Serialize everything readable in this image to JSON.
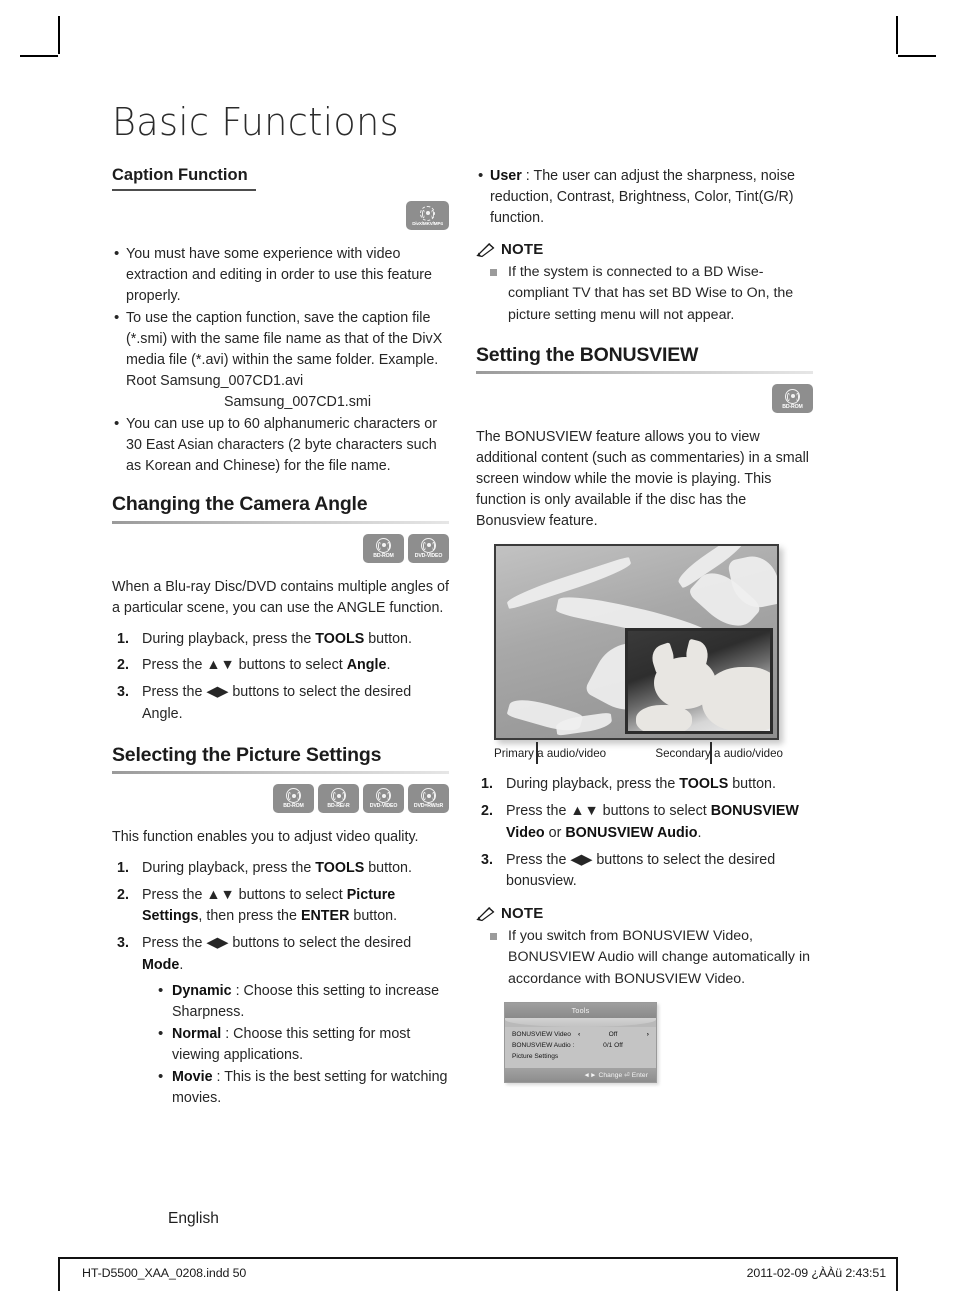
{
  "page": {
    "chapter_title": "Basic Functions",
    "language_label": "English",
    "footer_left": "HT-D5500_XAA_0208.indd   50",
    "footer_right": "2011-02-09   ¿ÀÀü 2:43:51"
  },
  "icons": {
    "divx": "DivX/MKV/MP4",
    "bd_rom": "BD-ROM",
    "bd_re_r": "BD-RE/-R",
    "dvd_video": "DVD-VIDEO",
    "dvd_rw_r": "DVD=RW/±R"
  },
  "left_column": {
    "caption_function": {
      "heading": "Caption Function",
      "bullets": [
        "You must have some experience with video extraction and editing in order to use this feature properly.",
        "To use the caption function, save the caption file (*.smi) with the same file name as that of the DivX media file (*.avi) within the same folder. Example. Root Samsung_007CD1.avi",
        "You can use up to 60 alphanumeric characters or 30 East Asian characters (2 byte characters such as Korean and Chinese) for the file name."
      ],
      "indented_line": "Samsung_007CD1.smi"
    },
    "camera_angle": {
      "heading": "Changing the Camera Angle",
      "intro": "When a Blu-ray Disc/DVD contains multiple angles of a particular scene, you can use the ANGLE function.",
      "steps": [
        {
          "pre": "During playback, press the ",
          "bold": "TOOLS",
          "post": " button."
        },
        {
          "pre": "Press the ▲▼ buttons to select ",
          "bold": "Angle",
          "post": "."
        },
        {
          "pre": "Press the ◀▶ buttons to select the desired ",
          "bold": "",
          "post": "Angle."
        }
      ]
    },
    "picture_settings": {
      "heading": "Selecting the Picture Settings",
      "intro": "This function enables you to adjust video quality.",
      "step1_pre": "During playback, press the ",
      "step1_bold": "TOOLS",
      "step1_post": " button.",
      "step2_pre": "Press the ▲▼ buttons to select ",
      "step2_bold1": "Picture Settings",
      "step2_mid": ", then press the ",
      "step2_bold2": "ENTER",
      "step2_post": " button.",
      "step3_pre": "Press the ◀▶ buttons to select the desired ",
      "step3_bold": "Mode",
      "step3_post": ".",
      "modes": [
        {
          "name": "Dynamic",
          "desc": " : Choose this setting to increase Sharpness."
        },
        {
          "name": "Normal",
          "desc": " : Choose this setting for most viewing applications."
        },
        {
          "name": "Movie",
          "desc": " : This is the best setting for watching movies."
        }
      ]
    }
  },
  "right_column": {
    "user_mode": {
      "name": "User",
      "desc": " : The user can adjust the sharpness, noise reduction, Contrast, Brightness, Color, Tint(G/R) function."
    },
    "note1": {
      "label": "NOTE",
      "items": [
        "If the system is connected to a BD Wise-compliant TV that has set BD Wise to On, the picture setting menu will not appear."
      ]
    },
    "bonusview": {
      "heading": "Setting the BONUSVIEW",
      "intro": "The BONUSVIEW feature allows you to view additional content (such as commentaries) in a small screen window while the movie is playing. This function is only available if the disc has the Bonusview feature.",
      "caption_primary": "Primary a audio/video",
      "caption_secondary": "Secondary a audio/video",
      "steps": {
        "s1_pre": "During playback, press the ",
        "s1_bold": "TOOLS",
        "s1_post": " button.",
        "s2_pre": "Press the ▲▼ buttons to select ",
        "s2_bold1": "BONUSVIEW Video",
        "s2_mid": " or ",
        "s2_bold2": "BONUSVIEW Audio",
        "s2_post": ".",
        "s3_text": "Press the ◀▶ buttons to select the desired bonusview."
      }
    },
    "note2": {
      "label": "NOTE",
      "items": [
        "If you switch from BONUSVIEW Video, BONUSVIEW Audio will change automatically in accordance with BONUSVIEW Video."
      ]
    },
    "osd": {
      "title": "Tools",
      "rows": [
        {
          "key": "BONUSVIEW Video",
          "arrow_left": "‹",
          "value": "Off",
          "arrow_right": "›"
        },
        {
          "key": "BONUSVIEW Audio :",
          "arrow_left": "",
          "value": "0/1 Off",
          "arrow_right": ""
        },
        {
          "key": "Picture Settings",
          "arrow_left": "",
          "value": "",
          "arrow_right": ""
        }
      ],
      "footer": "◄► Change   ⏎ Enter"
    }
  }
}
